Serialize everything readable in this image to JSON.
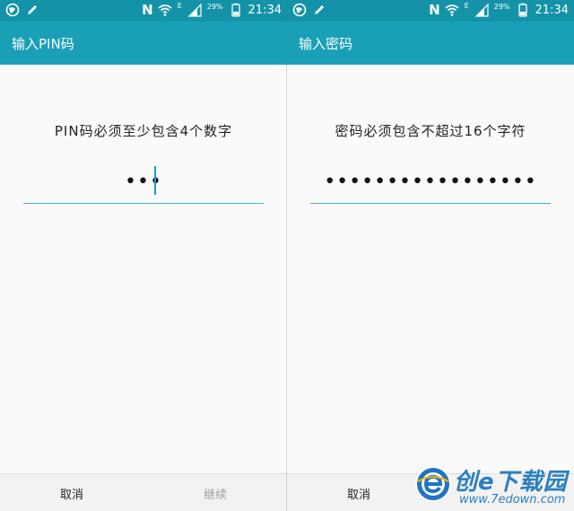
{
  "status_bar": {
    "network_badge": "N",
    "network_type": "E",
    "battery_percent": "29%",
    "time": "21:34"
  },
  "left_screen": {
    "title": "输入PIN码",
    "prompt": "PIN码必须至少包含4个数字",
    "input_value": "•••",
    "cancel_label": "取消",
    "continue_label": "继续"
  },
  "right_screen": {
    "title": "输入密码",
    "prompt": "密码必须包含不超过16个字符",
    "input_value": "•••••••••••••••••",
    "cancel_label": "取消"
  },
  "watermark": {
    "brand": "创e下载园",
    "url": "www.7edown.com"
  },
  "colors": {
    "status_bar": "#1493a8",
    "app_bar": "#1aa0b6",
    "accent_line": "#42b4c9",
    "background": "#fafafa",
    "disabled_text": "#9e9e9e"
  }
}
